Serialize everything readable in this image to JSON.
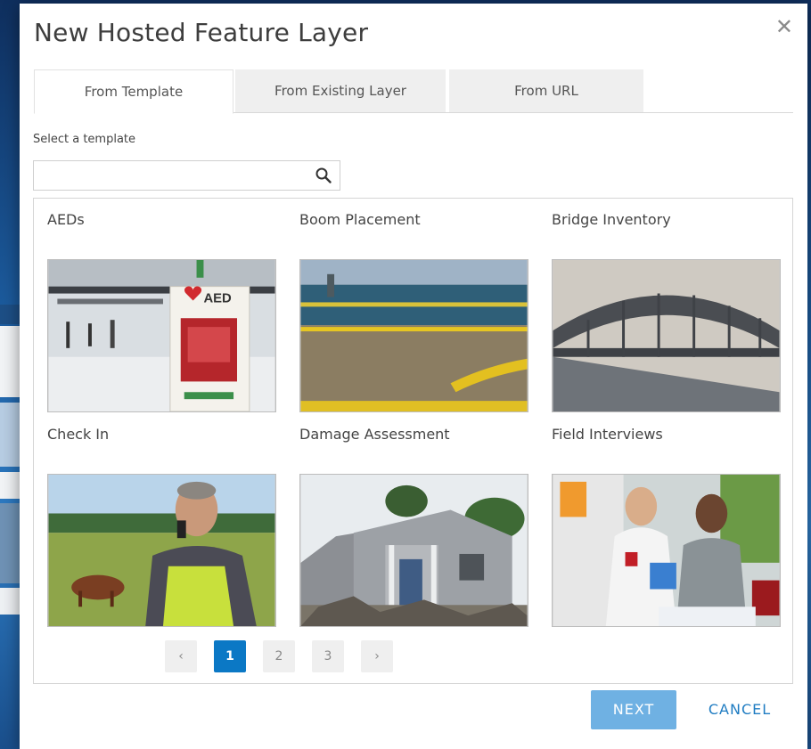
{
  "dialog": {
    "title": "New Hosted Feature Layer",
    "close_icon": "close-icon"
  },
  "tabs": [
    {
      "label": "From Template",
      "active": true
    },
    {
      "label": "From Existing Layer",
      "active": false
    },
    {
      "label": "From URL",
      "active": false
    }
  ],
  "search": {
    "label": "Select a template",
    "value": "",
    "placeholder": "",
    "icon": "search-icon"
  },
  "templates": [
    {
      "label": "AEDs"
    },
    {
      "label": "Boom Placement"
    },
    {
      "label": "Bridge Inventory"
    },
    {
      "label": "Check In"
    },
    {
      "label": "Damage Assessment"
    },
    {
      "label": "Field Interviews"
    }
  ],
  "aed_sign": "AED",
  "pagination": {
    "prev": "‹",
    "pages": [
      "1",
      "2",
      "3"
    ],
    "current": "1",
    "next": "›"
  },
  "buttons": {
    "next": "NEXT",
    "cancel": "CANCEL"
  },
  "colors": {
    "accent": "#0b78c5",
    "next_button": "#6fb1e3",
    "cancel_text": "#1f7cc2"
  }
}
